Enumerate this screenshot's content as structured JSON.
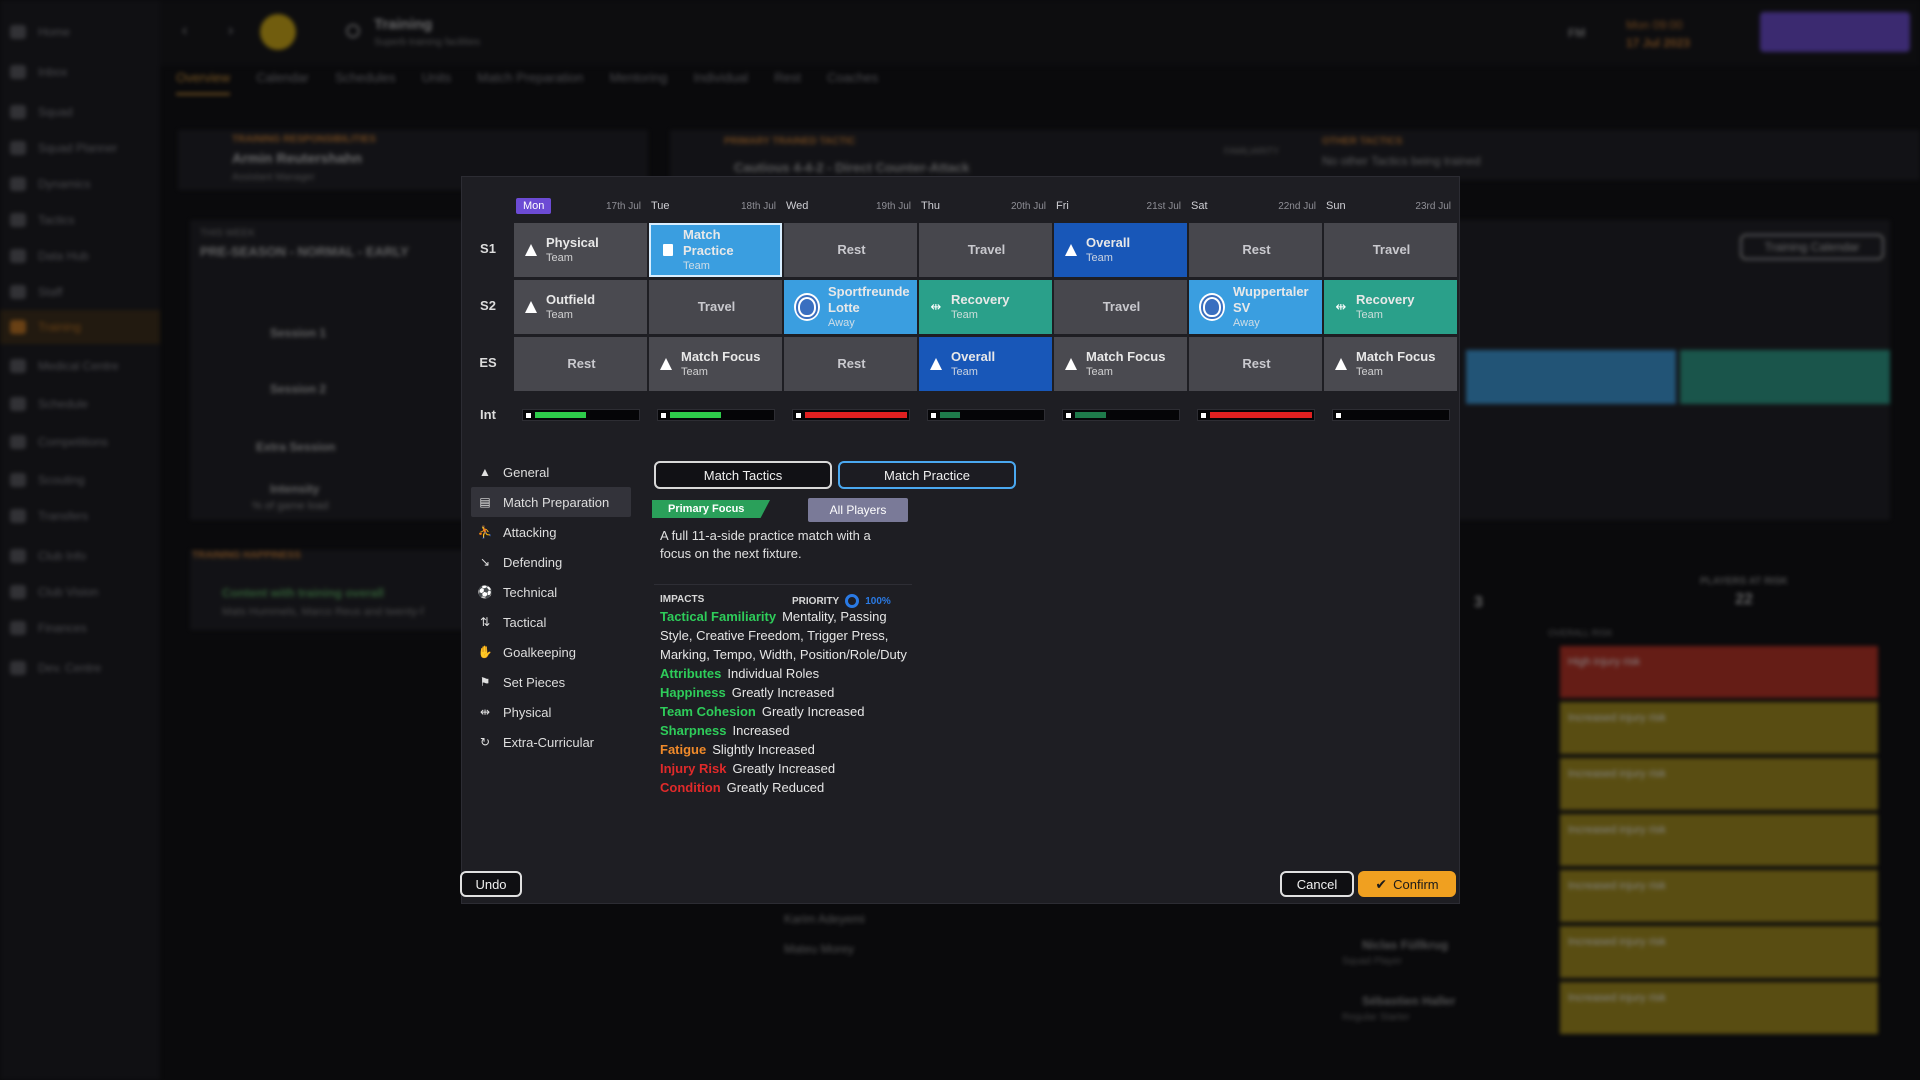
{
  "sidebar": {
    "items": [
      "Home",
      "Inbox",
      "Squad",
      "Squad Planner",
      "Dynamics",
      "Tactics",
      "Data Hub",
      "Staff",
      "Training",
      "Medical Centre",
      "Schedule",
      "Competitions",
      "Scouting",
      "Transfers",
      "Club Info",
      "Club Vision",
      "Finances",
      "Dev. Centre"
    ],
    "active": "Training"
  },
  "topbar": {
    "title": "Training",
    "subtitle": "Superb training facilities",
    "fm": "FM",
    "time": "Mon 09:00",
    "date": "17 Jul 2023"
  },
  "tabs": [
    "Overview",
    "Calendar",
    "Schedules",
    "Units",
    "Match Preparation",
    "Mentoring",
    "Individual",
    "Rest",
    "Coaches"
  ],
  "background": {
    "responsibilities_label": "TRAINING RESPONSIBILITIES",
    "manager_name": "Armin Reutershahn",
    "manager_role": "Assistant Manager",
    "primary_tactic_label": "PRIMARY TRAINED TACTIC",
    "tactic_name": "Cautious 4-4-2 - Direct Counter-Attack",
    "familiarity_label": "FAMILIARITY",
    "other_tactics_label": "OTHER TACTICS",
    "other_tactics_value": "No other Tactics being trained",
    "this_week_label": "THIS WEEK",
    "this_week_value": "PRE-SEASON - NORMAL - EARLY",
    "training_calendar_button": "Training Calendar",
    "rows": [
      "Session 1",
      "Session 2",
      "Extra Session"
    ],
    "intensity": "Intensity",
    "intensity_sub": "% of game load",
    "happiness_label": "TRAINING HAPPINESS",
    "happiness_title": "Content with training overall",
    "happiness_sub": "Mats Hummels, Marco Reus and twenty-f",
    "players_at_risk_label": "PLAYERS AT RISK",
    "players_at_risk_value": "22",
    "injuries_value": "3",
    "overall_risk": "OVERALL RISK",
    "players": [
      "Karim Adeyemi",
      "Mateu Morey"
    ],
    "risk_players": [
      {
        "name": "Niclas Füllkrug",
        "role": "Squad Player"
      },
      {
        "name": "Sébastien Haller",
        "role": "Regular Starter"
      }
    ],
    "risk_items": [
      "High injury risk",
      "Increased injury risk",
      "Increased injury risk",
      "Increased injury risk",
      "Increased injury risk",
      "Increased injury risk",
      "Increased injury risk"
    ]
  },
  "modal": {
    "days": [
      {
        "name": "Mon",
        "date": "17th Jul",
        "selected": true
      },
      {
        "name": "Tue",
        "date": "18th Jul"
      },
      {
        "name": "Wed",
        "date": "19th Jul"
      },
      {
        "name": "Thu",
        "date": "20th Jul"
      },
      {
        "name": "Fri",
        "date": "21st Jul"
      },
      {
        "name": "Sat",
        "date": "22nd Jul"
      },
      {
        "name": "Sun",
        "date": "23rd Jul"
      }
    ],
    "rows": [
      {
        "label": "S1",
        "cells": [
          {
            "title": "Physical",
            "sub": "Team",
            "style": "grey",
            "icon": "cone-icon"
          },
          {
            "title": "Match Practice",
            "sub": "Team",
            "style": "light",
            "icon": "match-practice-icon",
            "selected": true
          },
          {
            "title": "Rest",
            "style": "rest"
          },
          {
            "title": "Travel",
            "style": "rest"
          },
          {
            "title": "Overall",
            "sub": "Team",
            "style": "blue",
            "icon": "cone-icon"
          },
          {
            "title": "Rest",
            "style": "rest"
          },
          {
            "title": "Travel",
            "style": "rest"
          }
        ]
      },
      {
        "label": "S2",
        "cells": [
          {
            "title": "Outfield",
            "sub": "Team",
            "style": "grey",
            "icon": "cone-icon"
          },
          {
            "title": "Travel",
            "style": "rest"
          },
          {
            "title": "Sportfreunde Lotte",
            "sub": "Away",
            "style": "light",
            "icon": "club-crest-icon"
          },
          {
            "title": "Recovery",
            "sub": "Team",
            "style": "teal",
            "icon": "dumbbell-icon"
          },
          {
            "title": "Travel",
            "style": "rest"
          },
          {
            "title": "Wuppertaler SV",
            "sub": "Away",
            "style": "light",
            "icon": "club-crest-icon"
          },
          {
            "title": "Recovery",
            "sub": "Team",
            "style": "teal",
            "icon": "dumbbell-icon"
          }
        ]
      },
      {
        "label": "ES",
        "cells": [
          {
            "title": "Rest",
            "style": "rest"
          },
          {
            "title": "Match Focus",
            "sub": "Team",
            "style": "grey",
            "icon": "cone-icon"
          },
          {
            "title": "Rest",
            "style": "rest"
          },
          {
            "title": "Overall",
            "sub": "Team",
            "style": "blue",
            "icon": "cone-icon"
          },
          {
            "title": "Match Focus",
            "sub": "Team",
            "style": "grey",
            "icon": "cone-icon"
          },
          {
            "title": "Rest",
            "style": "rest"
          },
          {
            "title": "Match Focus",
            "sub": "Team",
            "style": "grey",
            "icon": "cone-icon"
          }
        ]
      }
    ],
    "intensity_label": "Int",
    "intensity": [
      {
        "level": 0.5,
        "color": "#2ecc4a"
      },
      {
        "level": 0.5,
        "color": "#2ecc4a"
      },
      {
        "level": 1.0,
        "color": "#e02020"
      },
      {
        "level": 0.2,
        "color": "#1e7a4a"
      },
      {
        "level": 0.3,
        "color": "#1e7a4a"
      },
      {
        "level": 1.0,
        "color": "#e02020"
      },
      {
        "level": 0.0,
        "color": "#1e7a4a"
      }
    ],
    "categories": [
      {
        "label": "General",
        "icon": "cone-icon"
      },
      {
        "label": "Match Preparation",
        "icon": "clipboard-icon",
        "active": true
      },
      {
        "label": "Attacking",
        "icon": "runner-icon"
      },
      {
        "label": "Defending",
        "icon": "tackle-icon"
      },
      {
        "label": "Technical",
        "icon": "kick-icon"
      },
      {
        "label": "Tactical",
        "icon": "tactics-icon"
      },
      {
        "label": "Goalkeeping",
        "icon": "goalkeeper-icon"
      },
      {
        "label": "Set Pieces",
        "icon": "flag-icon"
      },
      {
        "label": "Physical",
        "icon": "dumbbell-icon"
      },
      {
        "label": "Extra-Curricular",
        "icon": "extra-icon"
      }
    ],
    "tab_match_tactics": "Match Tactics",
    "tab_match_practice": "Match Practice",
    "primary_focus": "Primary Focus",
    "all_players": "All Players",
    "description": "A full 11-a-side practice match with a focus on the next fixture.",
    "impacts_label": "IMPACTS",
    "priority_label": "PRIORITY",
    "priority_value": "100%",
    "impacts": [
      {
        "key": "Tactical Familiarity",
        "value": "Mentality, Passing Style, Creative Freedom, Trigger Press, Marking, Tempo, Width, Position/Role/Duty",
        "color": "#2ecc5a"
      },
      {
        "key": "Attributes",
        "value": "Individual Roles",
        "color": "#2ecc5a"
      },
      {
        "key": "Happiness",
        "value": "Greatly Increased",
        "color": "#2ecc5a"
      },
      {
        "key": "Team Cohesion",
        "value": "Greatly Increased",
        "color": "#2ecc5a"
      },
      {
        "key": "Sharpness",
        "value": "Increased",
        "color": "#2ecc5a"
      },
      {
        "key": "Fatigue",
        "value": "Slightly Increased",
        "color": "#f08a2a"
      },
      {
        "key": "Injury Risk",
        "value": "Greatly Increased",
        "color": "#e02a2a"
      },
      {
        "key": "Condition",
        "value": "Greatly Reduced",
        "color": "#e02a2a"
      }
    ],
    "undo": "Undo",
    "cancel": "Cancel",
    "confirm": "Confirm"
  }
}
